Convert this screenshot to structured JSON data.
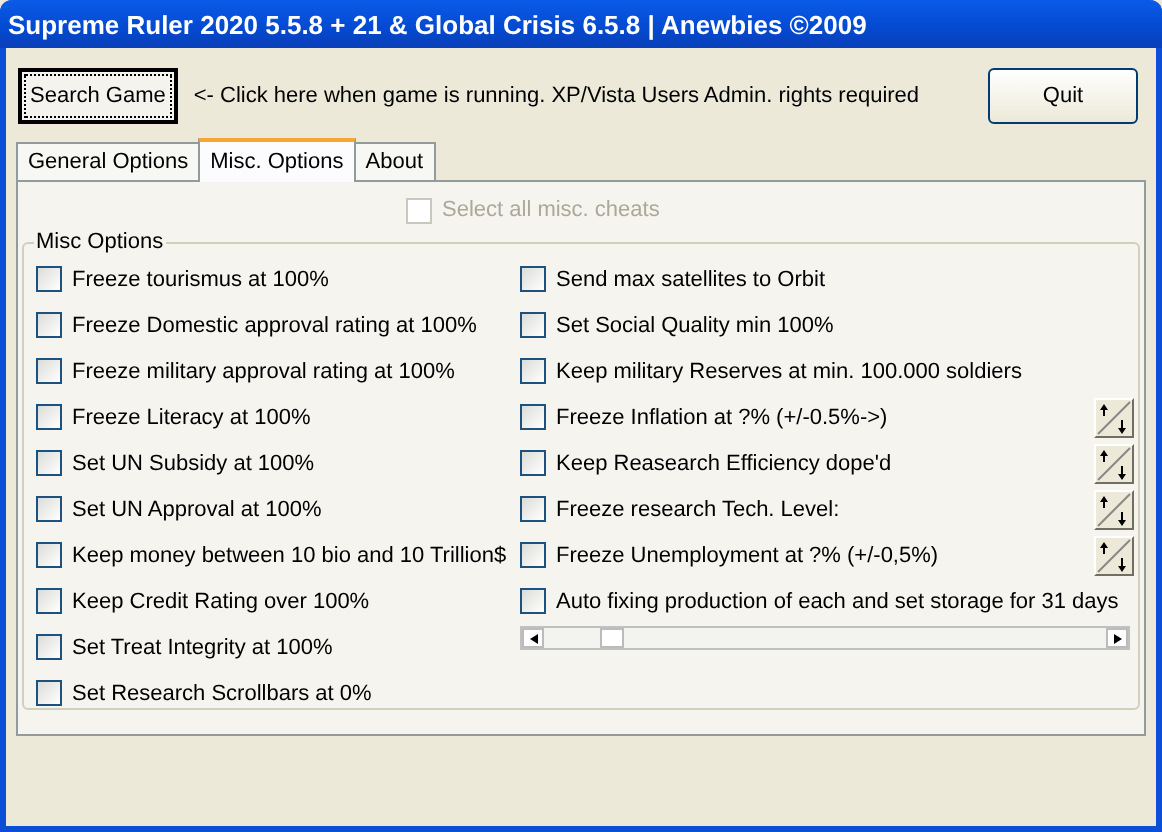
{
  "window": {
    "title": "Supreme Ruler 2020 5.5.8 + 21 & Global Crisis 6.5.8 | Anewbies ©2009"
  },
  "search_button": "Search Game",
  "hint": "<- Click here when game is running. XP/Vista Users Admin. rights required",
  "quit_button": "Quit",
  "tabs": [
    {
      "label": "General Options",
      "selected": false
    },
    {
      "label": "Misc. Options",
      "selected": true
    },
    {
      "label": "About",
      "selected": false
    }
  ],
  "select_all": {
    "label": "Select all misc. cheats",
    "checked": false,
    "disabled": true
  },
  "group": {
    "title": "Misc Options"
  },
  "left_options": [
    {
      "label": "Freeze tourismus at 100%",
      "checked": false
    },
    {
      "label": "Freeze Domestic approval rating at 100%",
      "checked": false
    },
    {
      "label": "Freeze military approval rating at 100%",
      "checked": false
    },
    {
      "label": "Freeze Literacy at 100%",
      "checked": false
    },
    {
      "label": "Set UN Subsidy at 100%",
      "checked": false
    },
    {
      "label": "Set UN Approval at 100%",
      "checked": false
    },
    {
      "label": "Keep money between 10 bio and 10 Trillion$",
      "checked": false
    },
    {
      "label": "Keep Credit Rating over 100%",
      "checked": false
    },
    {
      "label": "Set Treat Integrity at 100%",
      "checked": false
    },
    {
      "label": "Set Research Scrollbars at 0%",
      "checked": false
    }
  ],
  "right_options": [
    {
      "kind": "plain",
      "label": "Send max satellites to Orbit",
      "checked": false
    },
    {
      "kind": "plain",
      "label": "Set Social Quality min 100%",
      "checked": false
    },
    {
      "kind": "plain",
      "label": "Keep military Reserves at min. 100.000 soldiers",
      "checked": false
    },
    {
      "kind": "spin",
      "label": "Freeze Inflation at ?% (+/-0.5%->)",
      "checked": false
    },
    {
      "kind": "spin",
      "label": "Keep Reasearch Efficiency dope'd",
      "checked": false
    },
    {
      "kind": "spin",
      "label": "Freeze research Tech. Level:",
      "checked": false
    },
    {
      "kind": "spin",
      "label": "Freeze Unemployment at ?% (+/-0,5%)",
      "checked": false
    },
    {
      "kind": "plain",
      "label": "Auto fixing production of each and set storage for 31 days",
      "checked": false
    }
  ]
}
